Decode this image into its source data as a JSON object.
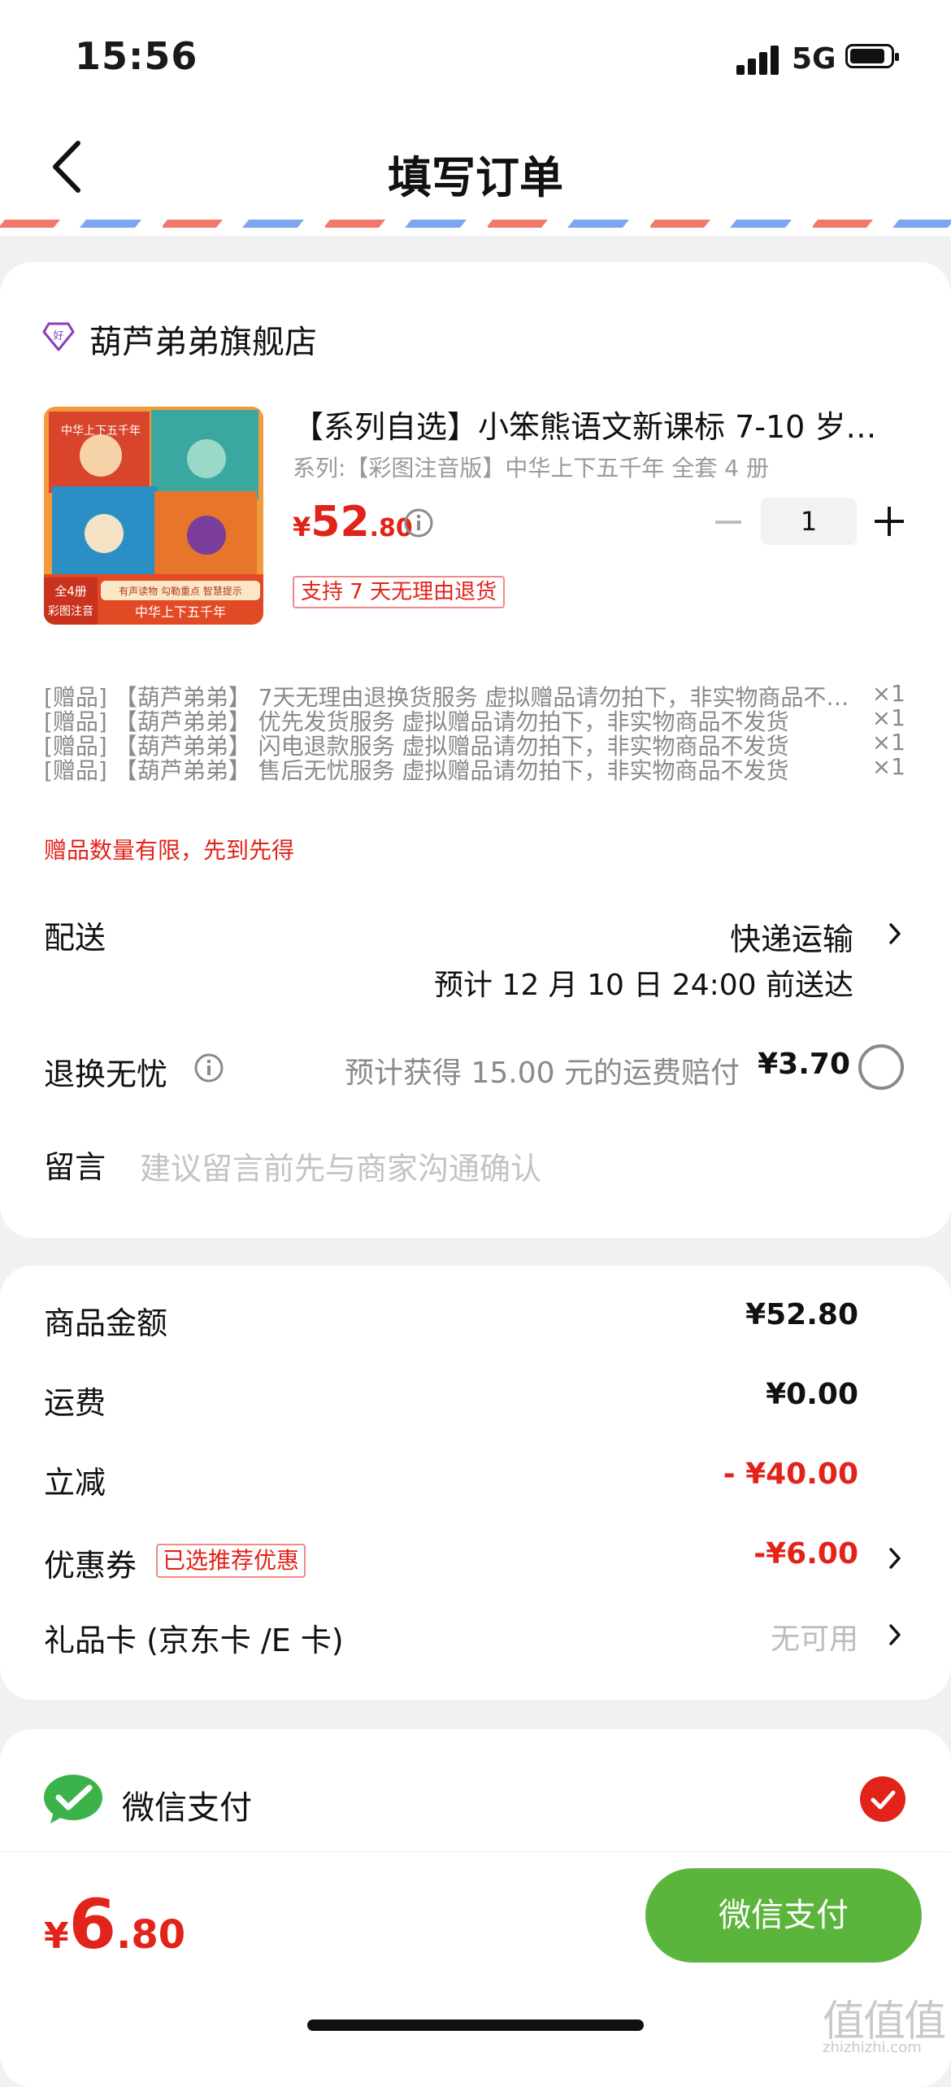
{
  "status_bar": {
    "time": "15:56",
    "network": "5G"
  },
  "nav": {
    "title": "填写订单"
  },
  "shop": {
    "name": "葫芦弟弟旗舰店",
    "icon": "diamond-good-icon"
  },
  "product": {
    "title": "【系列自选】小笨熊语文新课标 7-10 岁…",
    "spec": "系列:【彩图注音版】中华上下五千年 全套 4 册",
    "price_symbol": "¥",
    "price_int": "52",
    "price_dec": ".80",
    "quantity": "1",
    "return_tag": "支持 7 天无理由退货",
    "cover": {
      "badge_top": "全4册",
      "badge_bottom": "彩图注音",
      "banner": "有声读物 勾勒重点 智慧提示",
      "series_title": "中华上下五千年",
      "book_title": "中华上下五千年"
    }
  },
  "gifts": [
    {
      "text": "[赠品] 【葫芦弟弟】 7天无理由退换货服务 虚拟赠品请勿拍下，非实物商品不…",
      "qty": "×1"
    },
    {
      "text": "[赠品] 【葫芦弟弟】 优先发货服务 虚拟赠品请勿拍下，非实物商品不发货",
      "qty": "×1"
    },
    {
      "text": "[赠品] 【葫芦弟弟】 闪电退款服务 虚拟赠品请勿拍下，非实物商品不发货",
      "qty": "×1"
    },
    {
      "text": "[赠品] 【葫芦弟弟】 售后无忧服务 虚拟赠品请勿拍下，非实物商品不发货",
      "qty": "×1"
    }
  ],
  "gift_limit": "赠品数量有限，先到先得",
  "delivery": {
    "label": "配送",
    "method": "快递运输",
    "eta": "预计 12 月 10 日 24:00 前送达"
  },
  "worry_free": {
    "label": "退换无忧",
    "desc": "预计获得 15.00 元的运费赔付",
    "price": "¥3.70"
  },
  "message": {
    "label": "留言",
    "placeholder": "建议留言前先与商家沟通确认"
  },
  "summary": {
    "goods_label": "商品金额",
    "goods_value": "¥52.80",
    "shipping_label": "运费",
    "shipping_value": "¥0.00",
    "discount_label": "立减",
    "discount_value": "- ¥40.00",
    "coupon_label": "优惠券",
    "coupon_tag": "已选推荐优惠",
    "coupon_value": "-¥6.00",
    "giftcard_label": "礼品卡 (京东卡 /E 卡)",
    "giftcard_value": "无可用"
  },
  "payment": {
    "method": "微信支付",
    "selected": true
  },
  "bottom": {
    "total_symbol": "¥",
    "total_int": "6",
    "total_dec": ".80",
    "pay_button": "微信支付"
  },
  "watermark": {
    "logo": "值值值",
    "site": "zhizhizhi.com"
  },
  "colors": {
    "accent_red": "#e2231a",
    "wechat_green": "#5bb53c",
    "page_bg": "#f1f1f3"
  }
}
